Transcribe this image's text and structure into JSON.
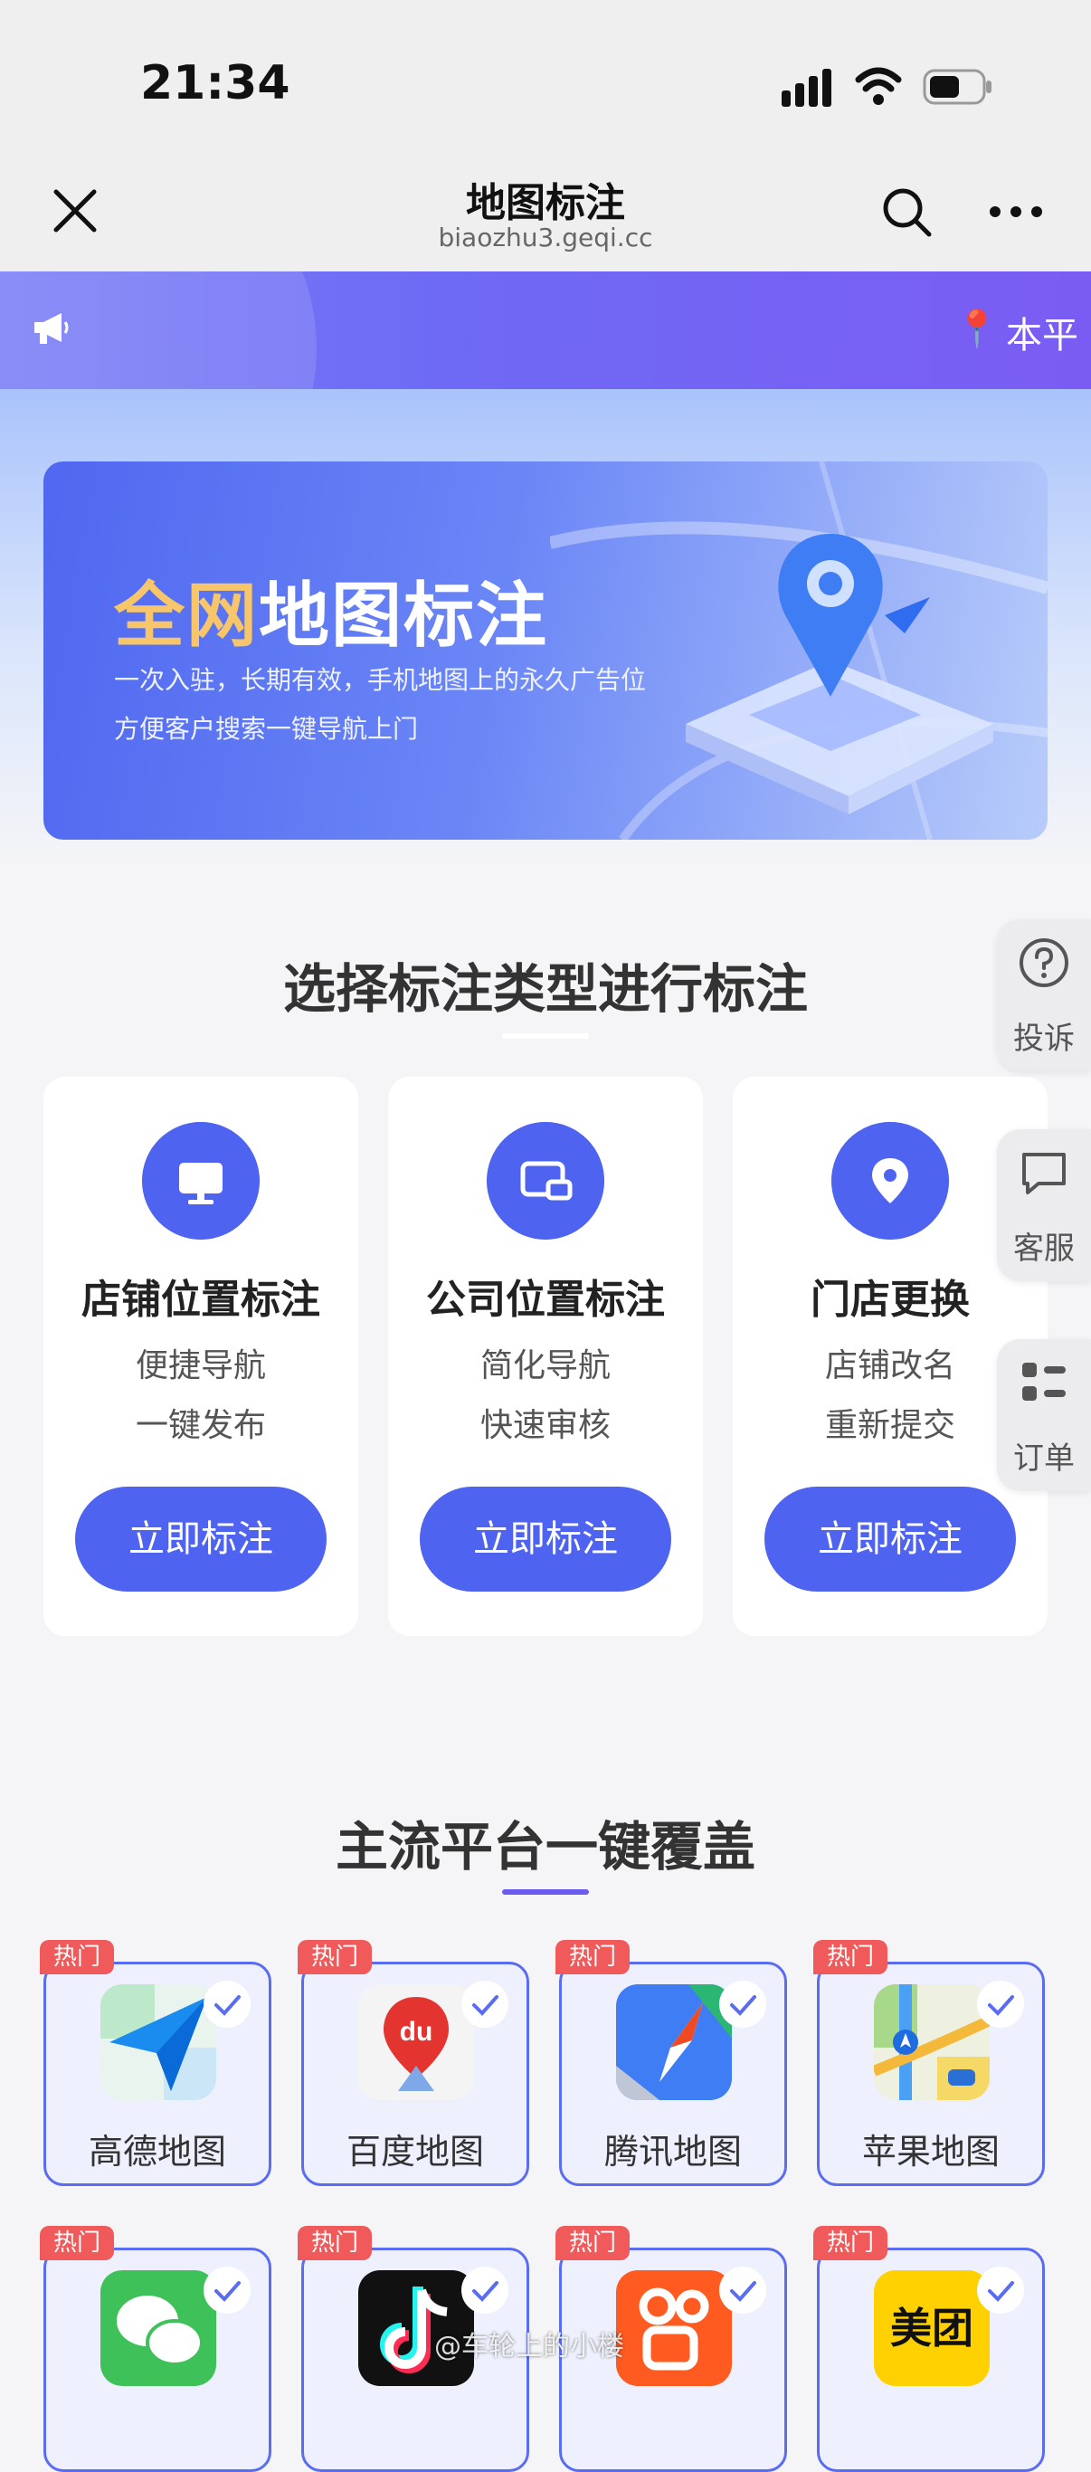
{
  "status_bar": {
    "time": "21:34"
  },
  "nav": {
    "title": "地图标注",
    "subtitle": "biaozhu3.geqi.cc"
  },
  "notice": {
    "text": "本平"
  },
  "banner": {
    "title_highlight": "全网",
    "title_rest": "地图标注",
    "line1": "一次入驻，长期有效，手机地图上的永久广告位",
    "line2": "方便客户搜索一键导航上门"
  },
  "section1": {
    "title": "选择标注类型进行标注",
    "cards": [
      {
        "title": "店铺位置标注",
        "sub1": "便捷导航",
        "sub2": "一键发布",
        "button": "立即标注",
        "icon": "monitor-icon"
      },
      {
        "title": "公司位置标注",
        "sub1": "简化导航",
        "sub2": "快速审核",
        "button": "立即标注",
        "icon": "screen-cast-icon"
      },
      {
        "title": "门店更换",
        "sub1": "店铺改名",
        "sub2": "重新提交",
        "button": "立即标注",
        "icon": "location-pin-icon"
      }
    ]
  },
  "side": [
    {
      "label": "投诉",
      "icon": "question-icon"
    },
    {
      "label": "客服",
      "icon": "chat-icon"
    },
    {
      "label": "订单",
      "icon": "list-icon"
    }
  ],
  "section2": {
    "title": "主流平台一键覆盖",
    "hot_label": "热门",
    "platforms": [
      {
        "name": "高德地图",
        "icon": "amap-icon"
      },
      {
        "name": "百度地图",
        "icon": "baidu-map-icon"
      },
      {
        "name": "腾讯地图",
        "icon": "tencent-map-icon"
      },
      {
        "name": "苹果地图",
        "icon": "apple-maps-icon"
      },
      {
        "name": "",
        "icon": "wechat-icon"
      },
      {
        "name": "",
        "icon": "douyin-icon"
      },
      {
        "name": "",
        "icon": "kuaishou-icon"
      },
      {
        "name": "美团",
        "icon": "meituan-icon"
      }
    ]
  },
  "watermark": "@车轮上的小楼",
  "colors": {
    "accent": "#4e63f0",
    "hot": "#f05a5a",
    "highlight": "#f7c56a"
  }
}
